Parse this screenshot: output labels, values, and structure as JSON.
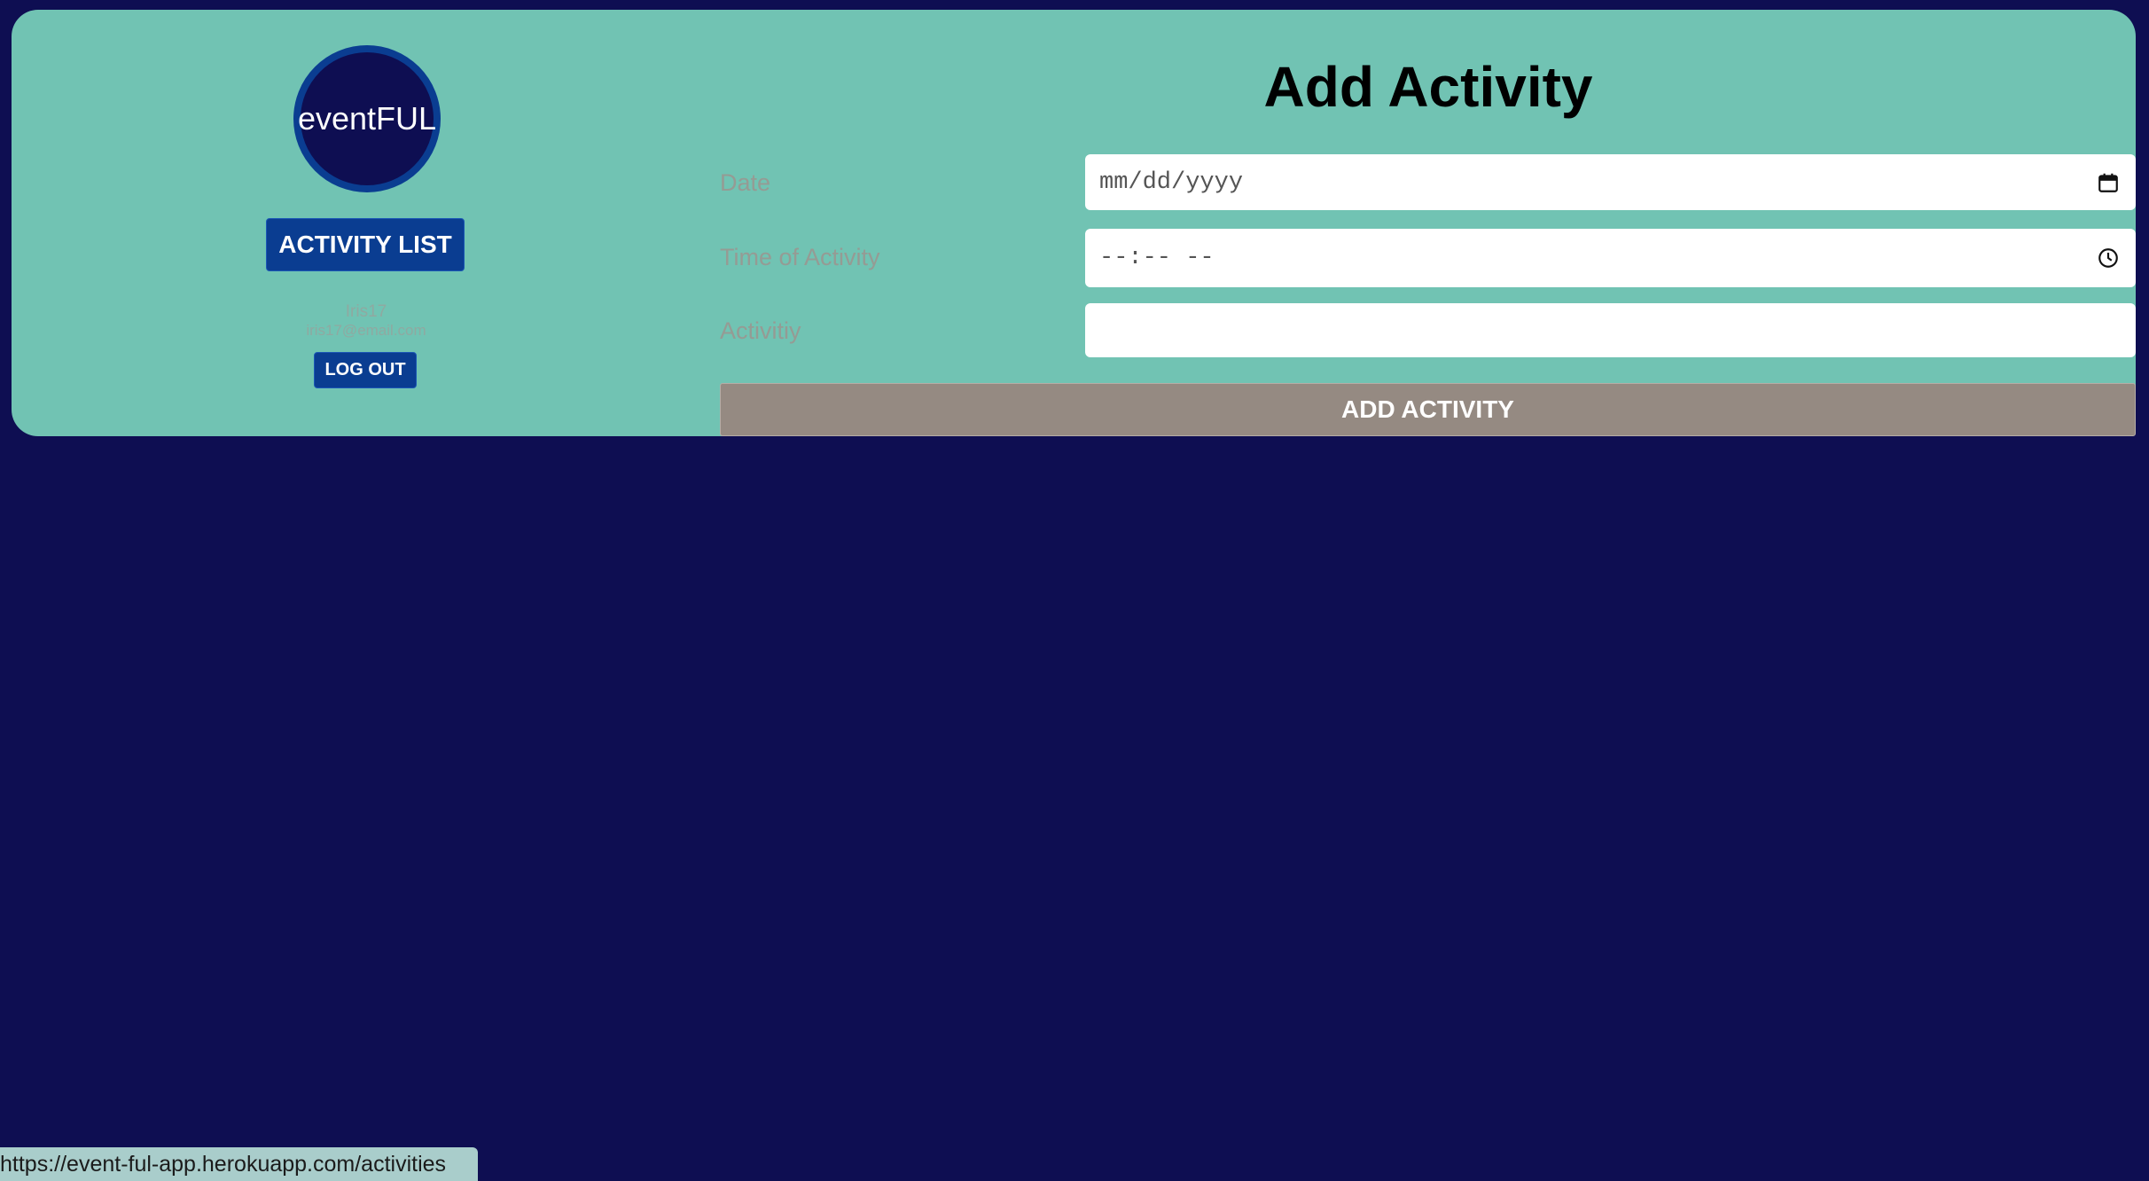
{
  "sidebar": {
    "logo_text": "eventFUL",
    "activity_list_label": "ACTIVITY LIST",
    "user_name": "Iris17",
    "user_email": "iris17@email.com",
    "logout_label": "LOG OUT"
  },
  "form": {
    "title": "Add Activity",
    "date_label": "Date",
    "date_placeholder": "mm/dd/yyyy",
    "time_label": "Time of Activity",
    "time_placeholder": "--:-- --",
    "activity_label": "Activitiy",
    "activity_value": "",
    "submit_label": "ADD ACTIVITY"
  },
  "status_bar": {
    "url": "https://event-ful-app.herokuapp.com/activities"
  },
  "colors": {
    "page_background": "#0e0e52",
    "panel_background": "#71c3b3",
    "primary_button": "#0a3d91",
    "submit_button": "#958a82"
  },
  "icons": {
    "date": "calendar-icon",
    "time": "clock-icon"
  }
}
